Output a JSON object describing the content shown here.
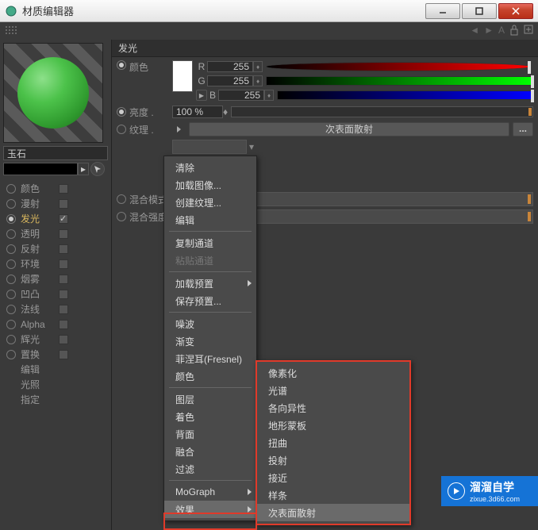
{
  "window": {
    "title": "材质编辑器"
  },
  "material_name": "玉石",
  "section_title": "发光",
  "color": {
    "label": "颜色",
    "r_label": "R",
    "r_value": "255",
    "g_label": "G",
    "g_value": "255",
    "b_label": "B",
    "b_value": "255"
  },
  "brightness": {
    "label": "亮度 .",
    "value": "100 %"
  },
  "texture": {
    "label": "纹理 .",
    "button": "次表面散射",
    "dots": "..."
  },
  "sub_fields": {
    "percent1": "%",
    "percent2": "%"
  },
  "mix_mode": {
    "label": "混合模式"
  },
  "mix_strength": {
    "label": "混合强度"
  },
  "channels": [
    {
      "label": "颜色",
      "on": false,
      "cb": false
    },
    {
      "label": "漫射",
      "on": false,
      "cb": false
    },
    {
      "label": "发光",
      "on": true,
      "cb": true
    },
    {
      "label": "透明",
      "on": false,
      "cb": false
    },
    {
      "label": "反射",
      "on": false,
      "cb": false
    },
    {
      "label": "环境",
      "on": false,
      "cb": false
    },
    {
      "label": "烟雾",
      "on": false,
      "cb": false
    },
    {
      "label": "凹凸",
      "on": false,
      "cb": false
    },
    {
      "label": "法线",
      "on": false,
      "cb": false
    },
    {
      "label": "Alpha",
      "on": false,
      "cb": false
    },
    {
      "label": "辉光",
      "on": false,
      "cb": false
    },
    {
      "label": "置换",
      "on": false,
      "cb": false
    }
  ],
  "sub_channels": [
    {
      "label": "编辑",
      "sel": false
    },
    {
      "label": "光照",
      "sel": false
    },
    {
      "label": "指定",
      "sel": false
    }
  ],
  "menu_main": [
    {
      "label": "清除",
      "type": "item"
    },
    {
      "label": "加载图像...",
      "type": "item"
    },
    {
      "label": "创建纹理...",
      "type": "item"
    },
    {
      "label": "编辑",
      "type": "item"
    },
    {
      "type": "sep"
    },
    {
      "label": "复制通道",
      "type": "item"
    },
    {
      "label": "粘贴通道",
      "type": "disabled"
    },
    {
      "type": "sep"
    },
    {
      "label": "加载预置",
      "type": "sub"
    },
    {
      "label": "保存预置...",
      "type": "item"
    },
    {
      "type": "sep"
    },
    {
      "label": "噪波",
      "type": "item"
    },
    {
      "label": "渐变",
      "type": "item"
    },
    {
      "label": "菲涅耳(Fresnel)",
      "type": "item"
    },
    {
      "label": "颜色",
      "type": "item"
    },
    {
      "type": "sep"
    },
    {
      "label": "图层",
      "type": "item"
    },
    {
      "label": "着色",
      "type": "item"
    },
    {
      "label": "背面",
      "type": "item"
    },
    {
      "label": "融合",
      "type": "item"
    },
    {
      "label": "过滤",
      "type": "item"
    },
    {
      "type": "sep"
    },
    {
      "label": "MoGraph",
      "type": "sub"
    },
    {
      "label": "效果",
      "type": "sub-hl"
    }
  ],
  "menu_effects": [
    "像素化",
    "光谱",
    "各向异性",
    "地形蒙板",
    "扭曲",
    "投射",
    "接近",
    "样条",
    "次表面散射"
  ],
  "watermark": {
    "zh": "溜溜自学",
    "en": "zixue.3d66.com"
  }
}
